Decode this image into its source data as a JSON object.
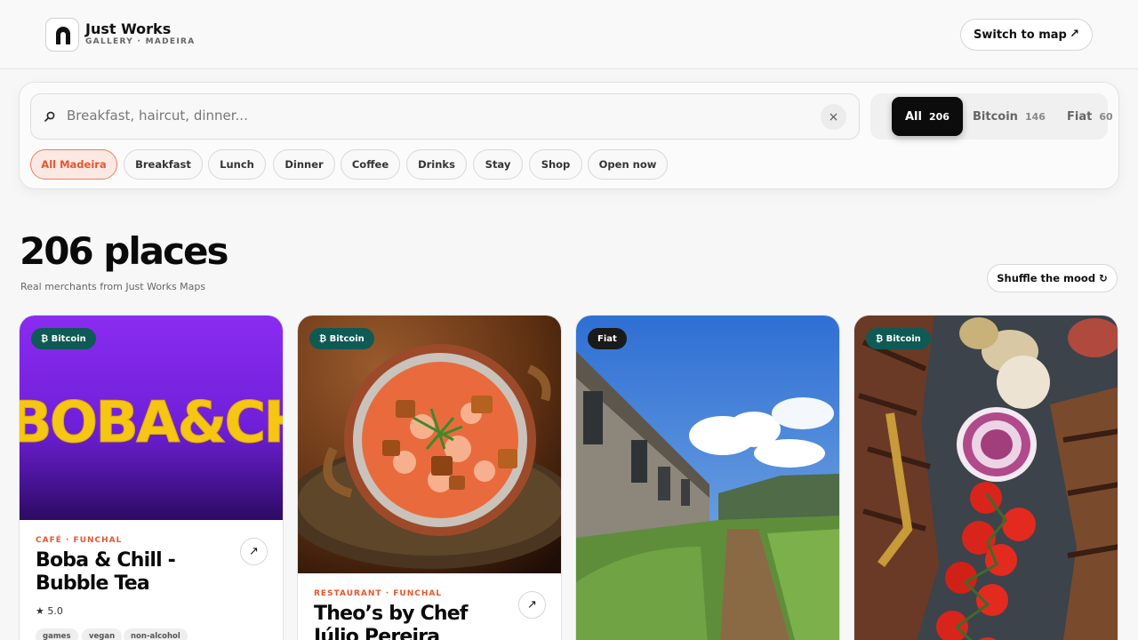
{
  "header": {
    "brand_title": "Just Works",
    "brand_subtitle": "GALLERY · MADEIRA",
    "logo_icon": "arch-icon",
    "map_button": "Switch to map",
    "map_button_icon": "↗"
  },
  "search": {
    "placeholder": "Breakfast, haircut, dinner...",
    "clear_icon": "×"
  },
  "payment_filter": {
    "options": [
      {
        "label": "All",
        "count": "206",
        "active": true
      },
      {
        "label": "Bitcoin",
        "count": "146",
        "active": false
      },
      {
        "label": "Fiat",
        "count": "60",
        "active": false
      }
    ]
  },
  "categories": [
    {
      "label": "All Madeira",
      "active": true
    },
    {
      "label": "Breakfast"
    },
    {
      "label": "Lunch"
    },
    {
      "label": "Dinner"
    },
    {
      "label": "Coffee"
    },
    {
      "label": "Drinks"
    },
    {
      "label": "Stay"
    },
    {
      "label": "Shop"
    },
    {
      "label": "Open now"
    }
  ],
  "main": {
    "count_title": "206 places",
    "subtitle": "Real merchants from Just Works Maps",
    "shuffle_button": "Shuffle the mood ↻"
  },
  "cards": [
    {
      "badge": "₿ Bitcoin",
      "category": "CAFÉ · FUNCHAL",
      "title": "Boba & Chill - Bubble Tea",
      "rating": "★ 5.0",
      "tags": [
        "games",
        "vegan",
        "non-alcohol"
      ],
      "image_text": "BOBA&CHILL"
    },
    {
      "badge": "₿ Bitcoin",
      "category": "RESTAURANT · FUNCHAL",
      "title": "Theo’s by Chef Júlio Pereira"
    },
    {
      "badge": "Fiat"
    },
    {
      "badge": "₿ Bitcoin"
    }
  ],
  "colors": {
    "accent": "#e5552d",
    "bitcoin_badge": "#0f5a55",
    "fiat_badge": "#1a1a1a",
    "active_segment": "#0c0c0c"
  }
}
